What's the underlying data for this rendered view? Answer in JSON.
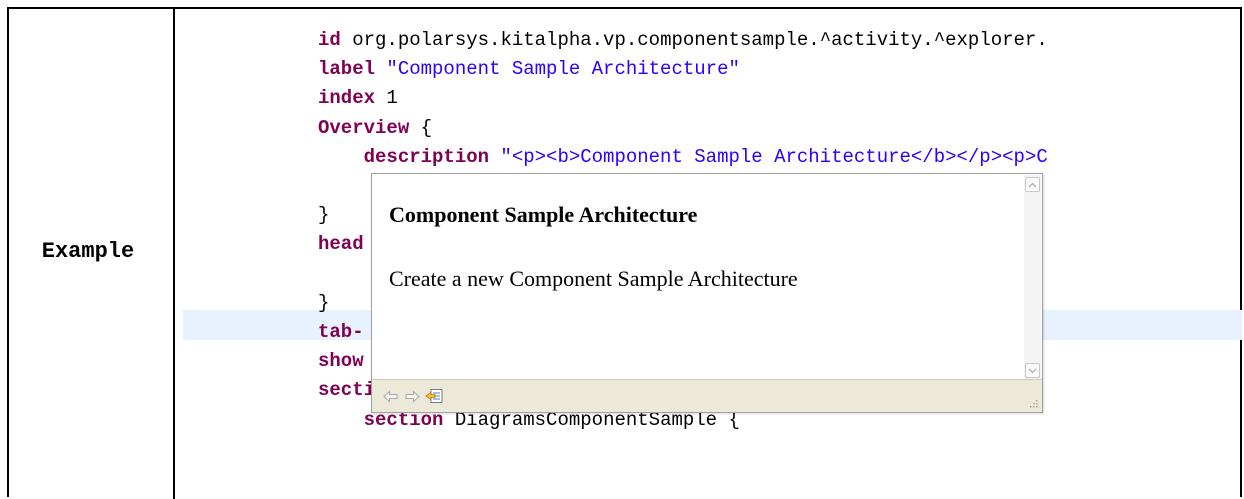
{
  "table": {
    "label": "Example"
  },
  "editor": {
    "lines": [
      {
        "indent": "",
        "keyword": "id",
        "rest": " org.polarsys.kitalpha.vp.componentsample.^activity.^explorer.",
        "kind": "plain"
      },
      {
        "indent": "",
        "keyword": "label",
        "rest": " \"Component Sample Architecture\"",
        "kind": "string"
      },
      {
        "indent": "",
        "keyword": "index",
        "rest": " 1",
        "kind": "number"
      },
      {
        "indent": "",
        "keyword": "Overview",
        "rest": " {",
        "kind": "plain"
      },
      {
        "indent": "    ",
        "keyword": "description",
        "rest": " \"<p><b>Component Sample Architecture</b></p><p>C",
        "kind": "string"
      },
      {
        "indent": "",
        "keyword": "",
        "rest": "",
        "kind": "plain"
      },
      {
        "indent": "",
        "keyword": "",
        "rest": "}",
        "kind": "plain"
      },
      {
        "indent": "",
        "keyword": "head",
        "rest": "",
        "kind": "plain"
      },
      {
        "indent": "",
        "keyword": "",
        "rest": "",
        "kind": "plain"
      },
      {
        "indent": "",
        "keyword": "",
        "rest": "}",
        "kind": "plain"
      },
      {
        "indent": "",
        "keyword": "tab-",
        "rest": "",
        "kind": "plain"
      },
      {
        "indent": "",
        "keyword": "show",
        "rest": "",
        "kind": "plain"
      },
      {
        "indent": "",
        "keyword": "sections",
        "rest": " {",
        "kind": "plain"
      },
      {
        "indent": "    ",
        "keyword": "section",
        "rest": " DiagramsComponentSample {",
        "kind": "plain"
      }
    ]
  },
  "hover_popup": {
    "title": "Component Sample Architecture",
    "body": "Create a new Component Sample Architecture",
    "icons": [
      "back-arrow-icon",
      "forward-arrow-icon",
      "open-declaration-icon",
      "resize-grip-icon",
      "scroll-up-icon",
      "scroll-down-icon"
    ]
  },
  "colors": {
    "keyword": "#7f0055",
    "string": "#2a00ff",
    "current_line": "#e8f2fe",
    "popup_status": "#ece9d8"
  }
}
